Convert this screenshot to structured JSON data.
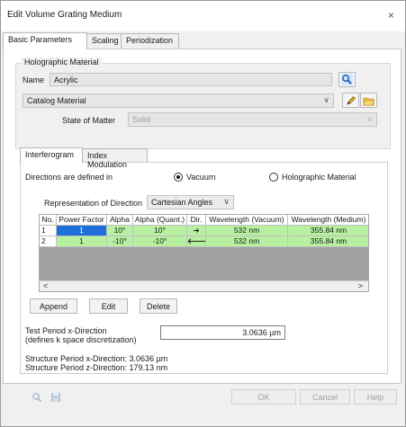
{
  "window": {
    "title": "Edit Volume Grating Medium",
    "close_glyph": "×"
  },
  "tabs": [
    {
      "label": "Basic Parameters",
      "active": true
    },
    {
      "label": "Scaling",
      "active": false
    },
    {
      "label": "Periodization",
      "active": false
    }
  ],
  "holographic_material": {
    "group_label": "Holographic Material",
    "name_label": "Name",
    "name_value": "Acrylic",
    "catalog_value": "Catalog Material",
    "state_label": "State of Matter",
    "state_value": "Solid"
  },
  "subtabs": [
    {
      "label": "Interferogram",
      "active": true
    },
    {
      "label": "Index Modulation",
      "active": false
    }
  ],
  "interferogram": {
    "directions_label": "Directions are defined in",
    "radio_vacuum": "Vacuum",
    "radio_holographic": "Holographic Material",
    "representation_label": "Representation of Direction",
    "representation_value": "Cartesian Angles"
  },
  "table": {
    "headers": [
      "No.",
      "Power Factor",
      "Alpha",
      "Alpha (Quant.)",
      "Dir.",
      "Wavelength (Vacuum)",
      "Wavelength (Medium)"
    ],
    "rows": [
      [
        "1",
        "1",
        "10°",
        "10°",
        "➔",
        "532 nm",
        "355.84 nm"
      ],
      [
        "2",
        "1",
        "-10°",
        "-10°",
        "🡐",
        "532 nm",
        "355.84 nm"
      ]
    ],
    "scroll_left": "<",
    "scroll_right": ">"
  },
  "buttons": {
    "append": "Append",
    "edit": "Edit",
    "delete": "Delete"
  },
  "period": {
    "label_line1": "Test Period x-Direction",
    "label_line2": "(defines k space discretization)",
    "value": "3.0636 µm",
    "structure_x": "Structure Period x-Direction: 3.0636 µm",
    "structure_z": "Structure Period z-Direction: 179.13 nm"
  },
  "footer": {
    "ok": "OK",
    "cancel": "Cancel",
    "help": "Help"
  },
  "colors": {
    "row_green": "#b6f0a0",
    "selection_blue": "#1e6fd9"
  }
}
